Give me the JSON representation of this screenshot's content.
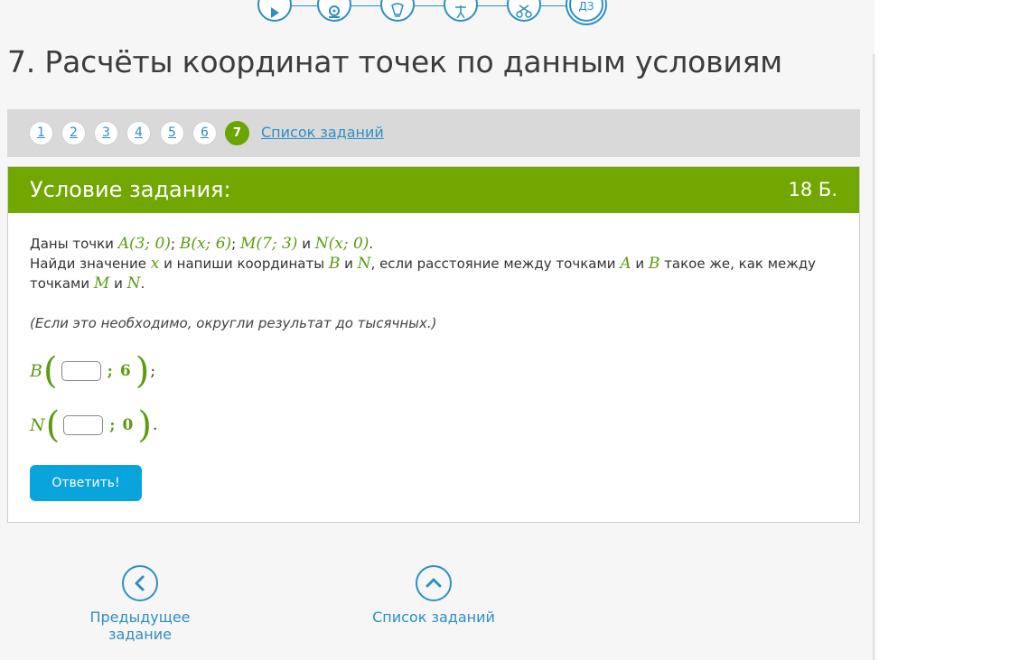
{
  "top_nav": {
    "items": [
      "play-icon",
      "webcam-icon",
      "lightbulb-icon",
      "exercise-icon",
      "tools-icon",
      "homework-icon"
    ],
    "homework_label": "ДЗ"
  },
  "page_title": "7. Расчёты координат точек по данным условиям",
  "task_tabs": {
    "items": [
      "1",
      "2",
      "3",
      "4",
      "5",
      "6",
      "7"
    ],
    "active": "7",
    "list_link": "Список заданий"
  },
  "task": {
    "header": "Условие задания:",
    "score": "18 Б.",
    "line1_prefix": "Даны точки",
    "points": {
      "A": "A(3; 0)",
      "B": "B(x; 6)",
      "M": "M(7; 3)",
      "N": "N(x; 0)"
    },
    "conj_and": "и",
    "line2_prefix": "Найди значение",
    "var_x": "x",
    "line2_mid": "и напиши координаты",
    "line2_tail": ", если расстояние между точками",
    "line2_end": "такое же, как между",
    "line3_prefix": "точками",
    "note": "(Если это необходимо, округли результат до тысячных.)",
    "answers": [
      {
        "var": "B",
        "second": "6",
        "end": ";"
      },
      {
        "var": "N",
        "second": "0",
        "end": "."
      }
    ],
    "submit_label": "Ответить!"
  },
  "bottom_nav": {
    "prev_label": "Предыдущее задание",
    "list_label": "Список заданий"
  },
  "colors": {
    "accent_green": "#72a600",
    "link_blue": "#2d8fc4",
    "button_blue": "#0aa4dc"
  }
}
